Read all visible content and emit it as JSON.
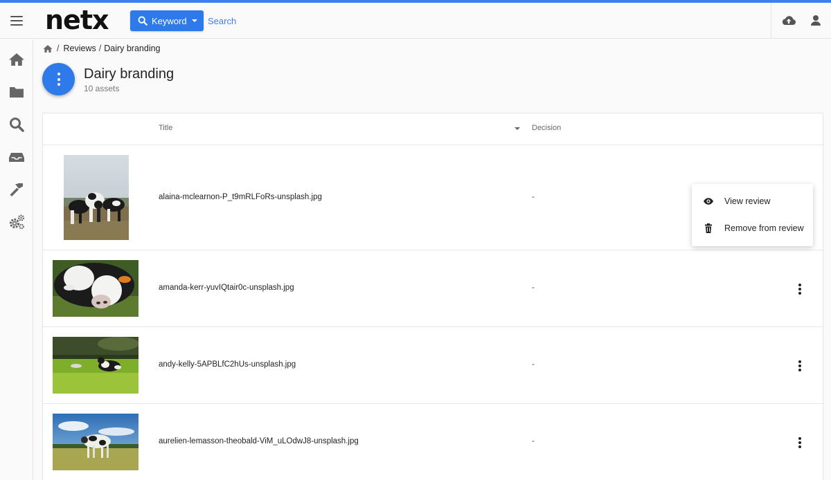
{
  "app": {
    "logo": "netx",
    "accent": "#2f7aea"
  },
  "header": {
    "search_mode_label": "Keyword",
    "search_placeholder": "Search",
    "icons": [
      "hamburger-icon",
      "cloud-upload-icon",
      "user-icon"
    ]
  },
  "sidebar": {
    "items": [
      "home-icon",
      "folder-icon",
      "search-icon",
      "inbox-icon",
      "hammer-icon",
      "cogs-icon"
    ]
  },
  "breadcrumb": {
    "home": "home-icon",
    "reviews": "Reviews",
    "current": "Dairy branding",
    "separator": "/"
  },
  "page": {
    "title": "Dairy branding",
    "subtitle": "10 assets"
  },
  "table": {
    "columns": {
      "title": "Title",
      "decision": "Decision"
    },
    "rows": [
      {
        "filename": "alaina-mclearnon-P_t9mRLFoRs-unsplash.jpg",
        "decision": "-"
      },
      {
        "filename": "amanda-kerr-yuvIQtair0c-unsplash.jpg",
        "decision": "-"
      },
      {
        "filename": "andy-kelly-5APBLfC2hUs-unsplash.jpg",
        "decision": "-"
      },
      {
        "filename": "aurelien-lemasson-theobald-ViM_uLOdwJ8-unsplash.jpg",
        "decision": "-"
      }
    ]
  },
  "context_menu": {
    "items": [
      {
        "label": "View review",
        "icon": "eye-icon"
      },
      {
        "label": "Remove from review",
        "icon": "trash-icon"
      }
    ]
  }
}
